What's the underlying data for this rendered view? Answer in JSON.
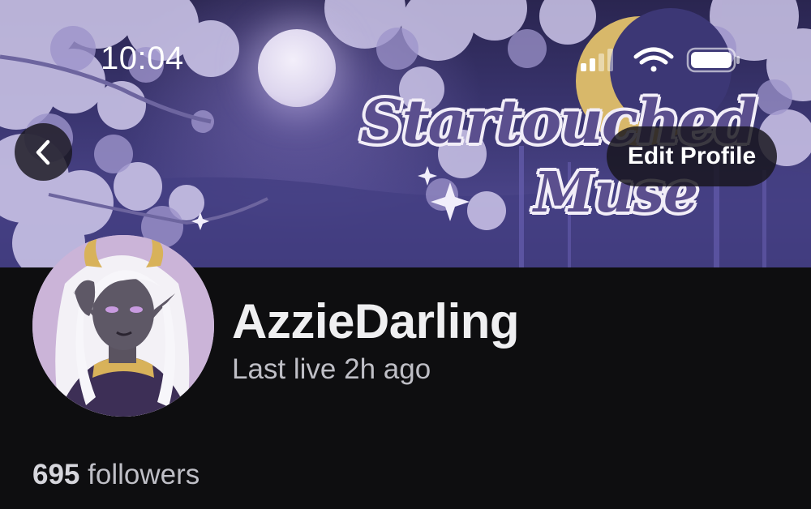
{
  "status_bar": {
    "time": "10:04",
    "icons": [
      "signal-icon",
      "wifi-icon",
      "battery-icon"
    ]
  },
  "banner": {
    "logo_line1": "Startouched",
    "logo_line2": "Muse",
    "colors": {
      "sky": "#3b3672",
      "logo_purple": "#5b4f8e",
      "moon_gold": "#d8b86a"
    }
  },
  "header": {
    "back_icon": "chevron-left-icon",
    "edit_profile_label": "Edit Profile"
  },
  "profile": {
    "username": "AzzieDarling",
    "last_live": "Last live 2h ago",
    "followers_count": "695",
    "followers_label": "followers"
  }
}
